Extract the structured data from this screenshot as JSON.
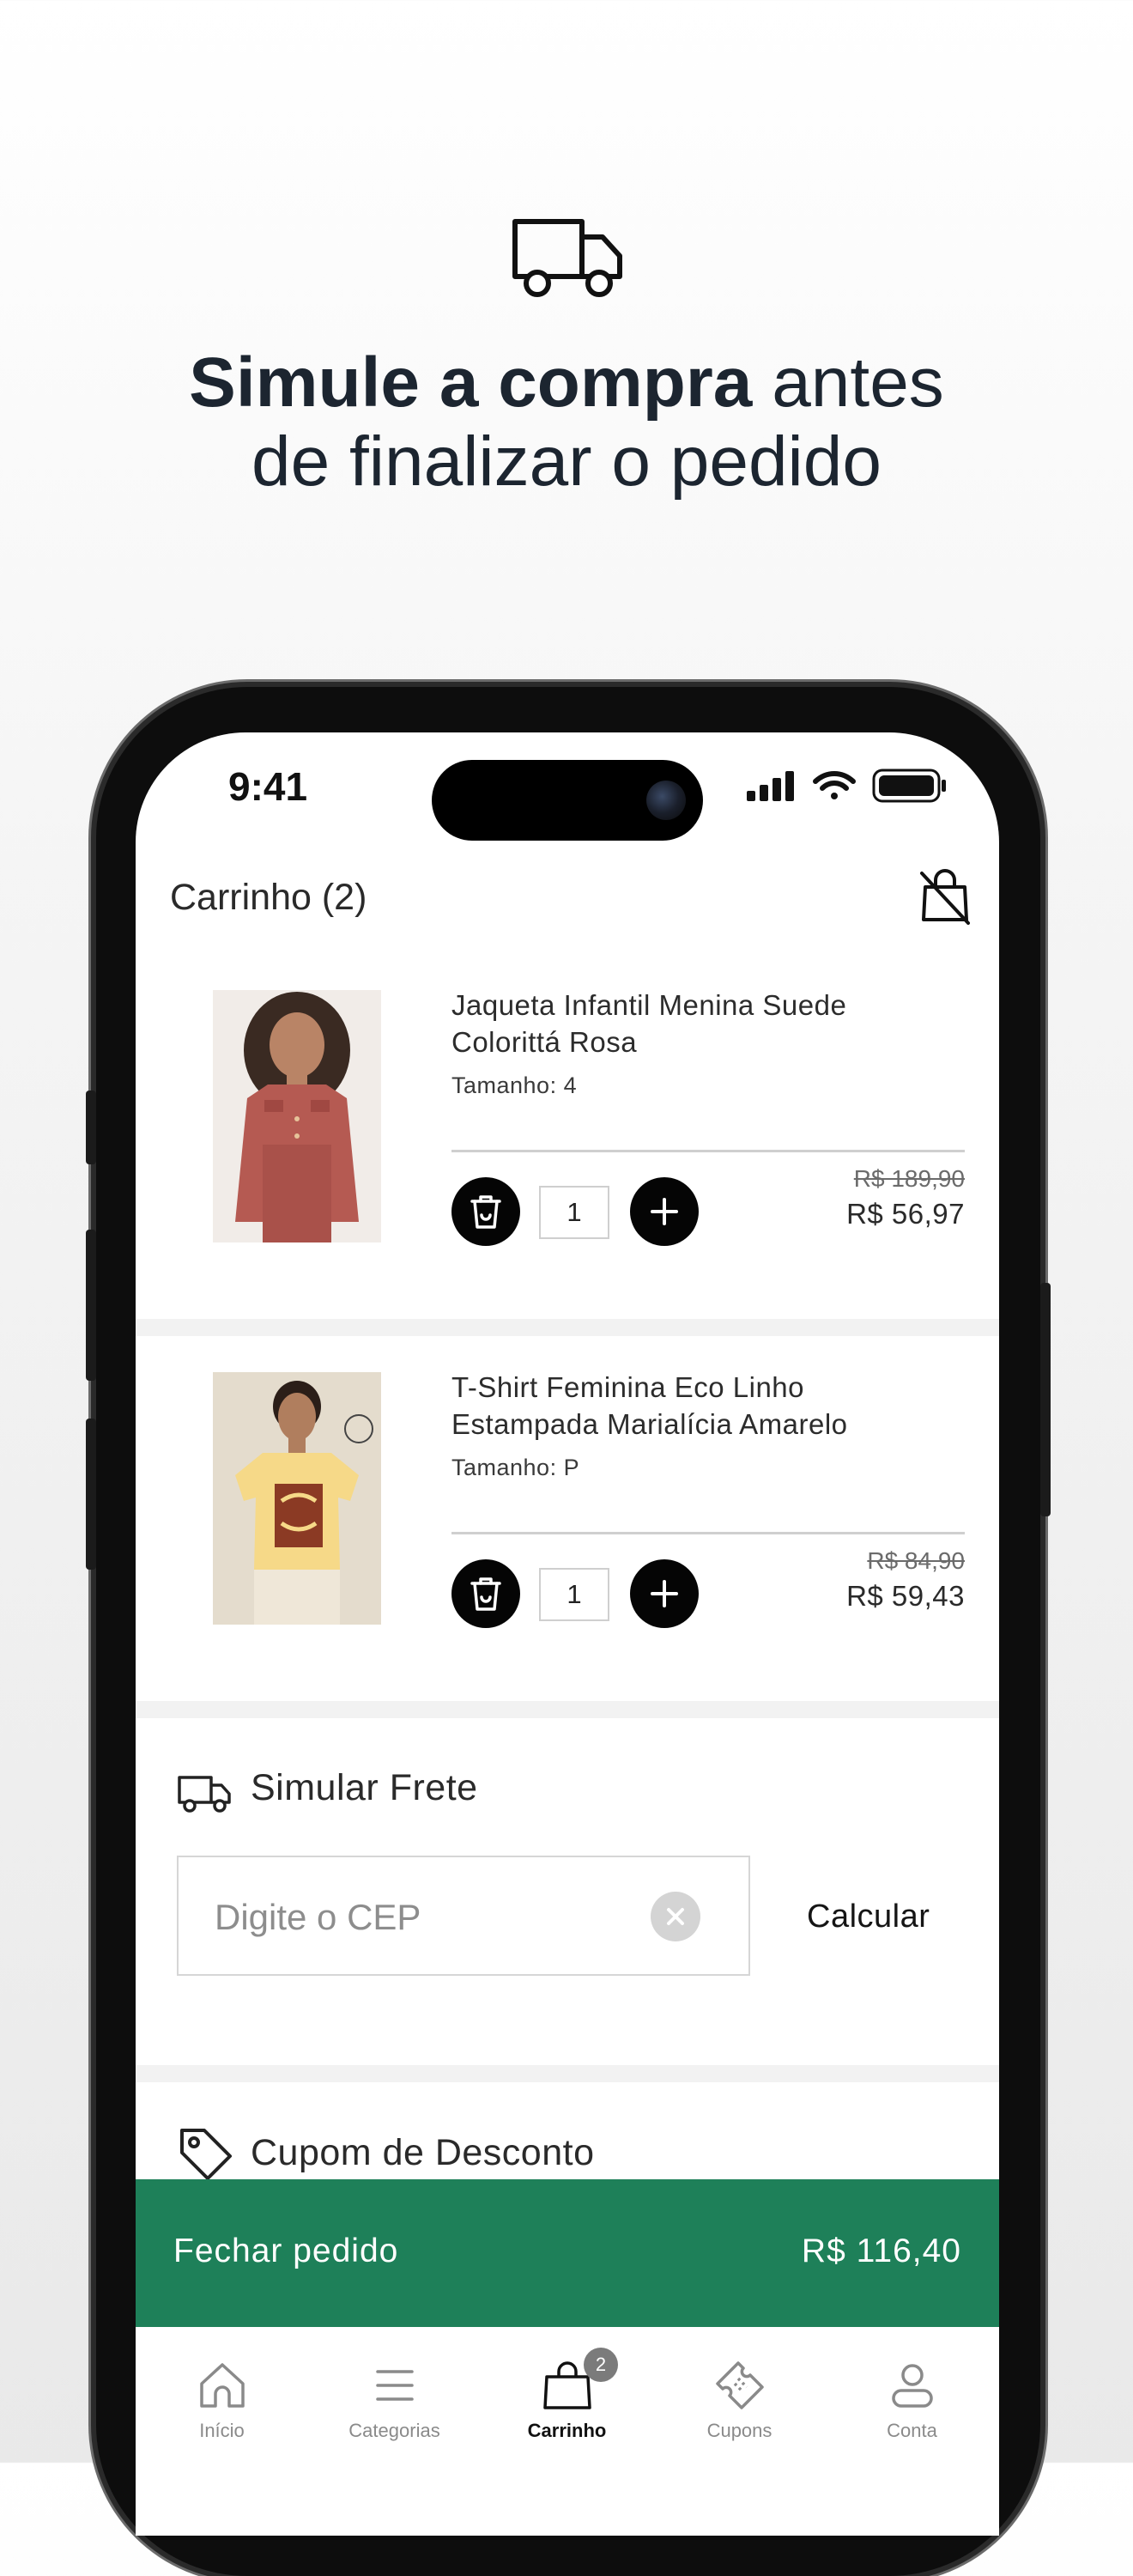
{
  "hero": {
    "headline_bold": "Simule a compra",
    "headline_rest_line1": " antes",
    "headline_line2": "de finalizar o pedido"
  },
  "status_bar": {
    "time": "9:41"
  },
  "cart": {
    "title": "Carrinho (2)",
    "items": [
      {
        "name": "Jaqueta Infantil Menina Suede Colorittá Rosa",
        "size": "Tamanho: 4",
        "quantity": "1",
        "old_price": "R$ 189,90",
        "price": "R$ 56,97"
      },
      {
        "name": "T-Shirt Feminina Eco Linho Estampada Marialícia Amarelo",
        "size": "Tamanho: P",
        "quantity": "1",
        "old_price": "R$ 84,90",
        "price": "R$ 59,43"
      }
    ]
  },
  "freight": {
    "title": "Simular Frete",
    "cep_placeholder": "Digite o CEP",
    "calculate_label": "Calcular"
  },
  "coupon": {
    "title": "Cupom de Desconto"
  },
  "checkout": {
    "label": "Fechar pedido",
    "total": "R$ 116,40"
  },
  "tabbar": {
    "items": [
      {
        "label": "Início",
        "icon": "home-icon"
      },
      {
        "label": "Categorias",
        "icon": "menu-icon"
      },
      {
        "label": "Carrinho",
        "icon": "bag-icon",
        "badge": "2",
        "active": true
      },
      {
        "label": "Cupons",
        "icon": "coupon-icon"
      },
      {
        "label": "Conta",
        "icon": "user-icon"
      }
    ]
  },
  "colors": {
    "accent_green": "#1e8059",
    "headline": "#1c2530"
  }
}
